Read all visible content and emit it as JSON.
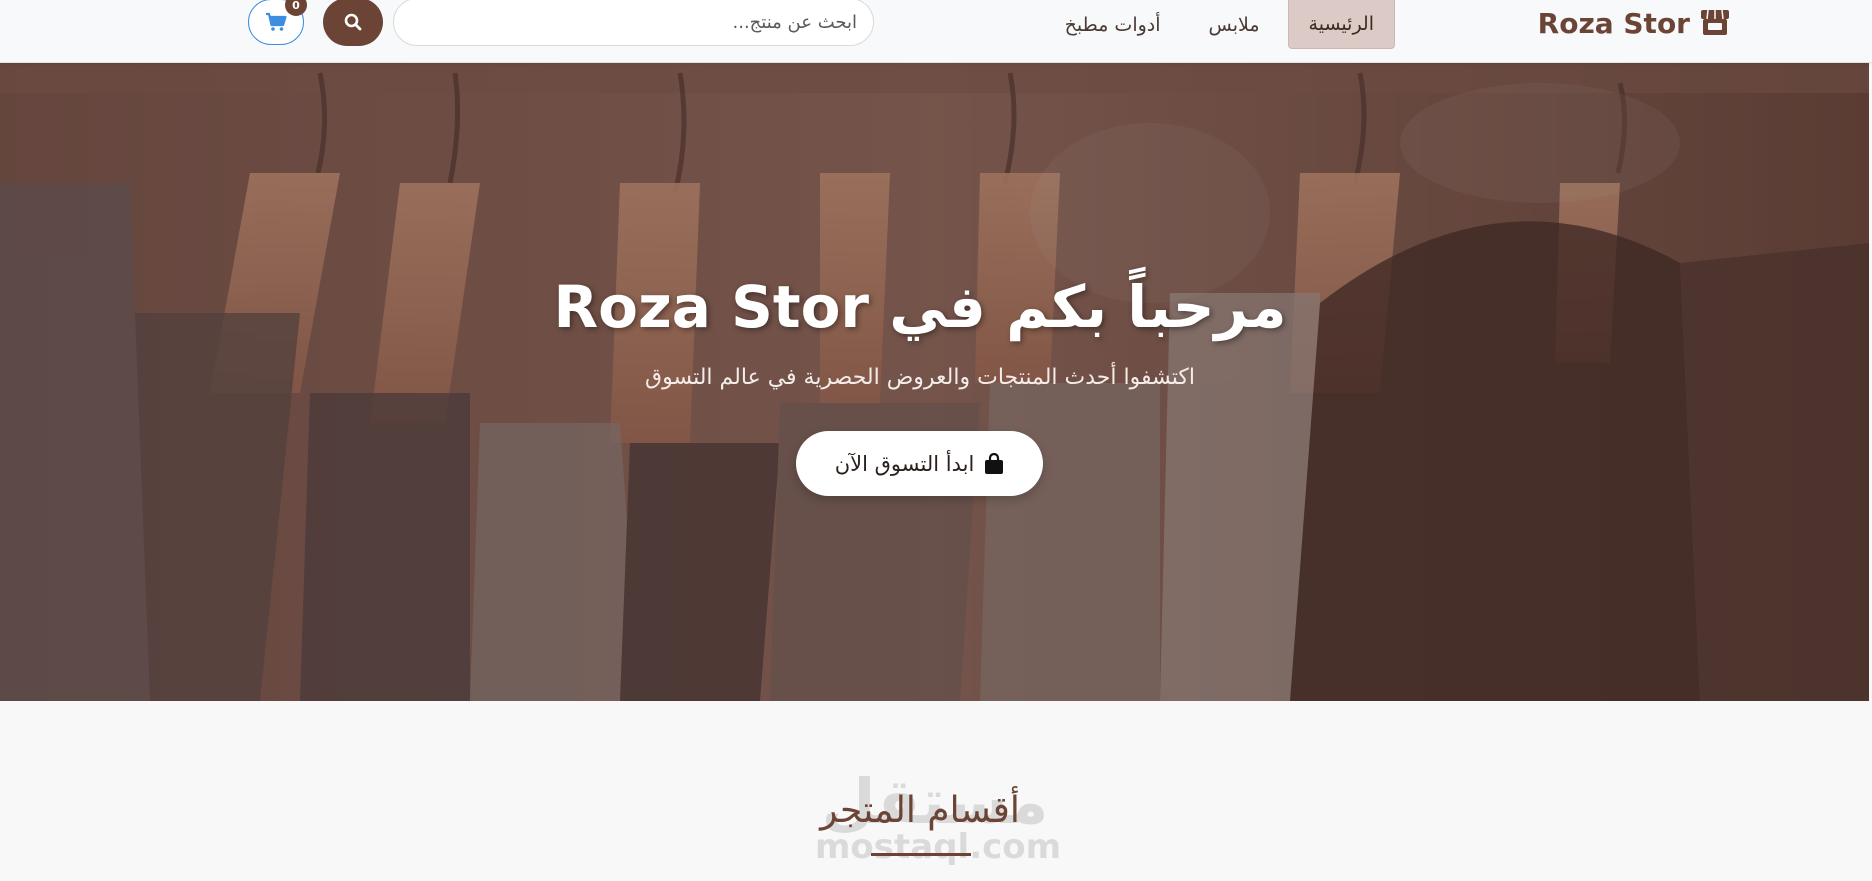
{
  "navbar": {
    "brand": "Roza Stor",
    "brand_icon": "store-icon",
    "links": [
      {
        "label": "الرئيسية",
        "active": true
      },
      {
        "label": "ملابس",
        "active": false
      },
      {
        "label": "أدوات مطبخ",
        "active": false
      }
    ],
    "search": {
      "placeholder": "ابحث عن منتج..."
    },
    "search_icon": "search-icon",
    "cart_icon": "cart-icon",
    "cart_count": "0"
  },
  "hero": {
    "title": "مرحباً بكم في Roza Stor",
    "subtitle": "اكتشفوا أحدث المنتجات والعروض الحصرية في عالم التسوق",
    "cta_label": "ابدأ التسوق الآن",
    "cta_icon": "shopping-bag-icon"
  },
  "section": {
    "title": "أقسام المتجر"
  },
  "watermark": {
    "arabic": "مستقل",
    "latin": "mostaql.com"
  },
  "colors": {
    "brand": "#6b4435",
    "active_nav_bg": "#dbcac5",
    "cart_border": "#3e8de0",
    "hero_overlay": "#5c3a30"
  }
}
